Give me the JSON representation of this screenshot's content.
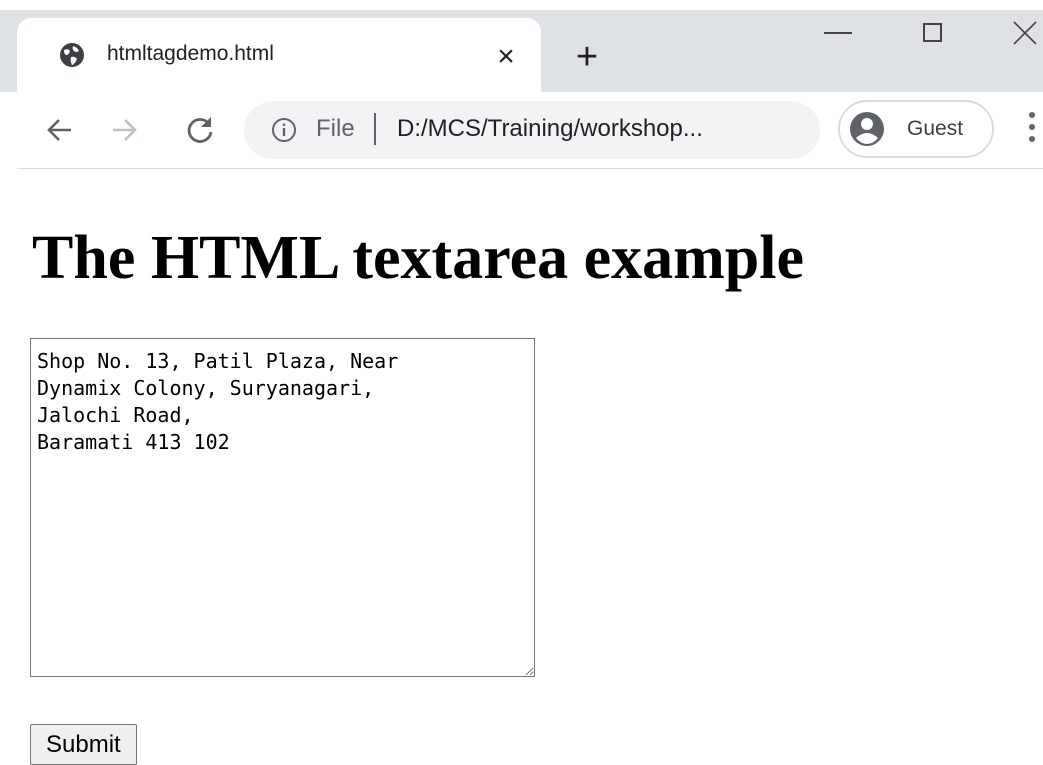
{
  "browser": {
    "tab": {
      "title": "htmltagdemo.html",
      "close_label": "×",
      "favicon": "globe-icon"
    },
    "new_tab_label": "+",
    "window_controls": [
      "minimize-icon",
      "maximize-icon",
      "close-icon"
    ],
    "nav": {
      "back": "arrow-left-icon",
      "forward": "arrow-right-icon",
      "reload": "reload-icon"
    },
    "omnibox": {
      "info_icon": "info-icon",
      "scheme_label": "File",
      "url": "D:/MCS/Training/workshop..."
    },
    "profile": {
      "label": "Guest",
      "icon": "avatar-icon"
    },
    "menu_icon": "more-vertical-icon"
  },
  "page": {
    "heading": "The HTML textarea example",
    "textarea_value": "Shop No. 13, Patil Plaza, Near\nDynamix Colony, Suryanagari,\nJalochi Road,\nBaramati 413 102",
    "submit_label": "Submit"
  },
  "colors": {
    "tabstrip": "#dee1e6",
    "omnibox": "#f1f3f4",
    "icon": "#5f6368",
    "text": "#202124"
  }
}
